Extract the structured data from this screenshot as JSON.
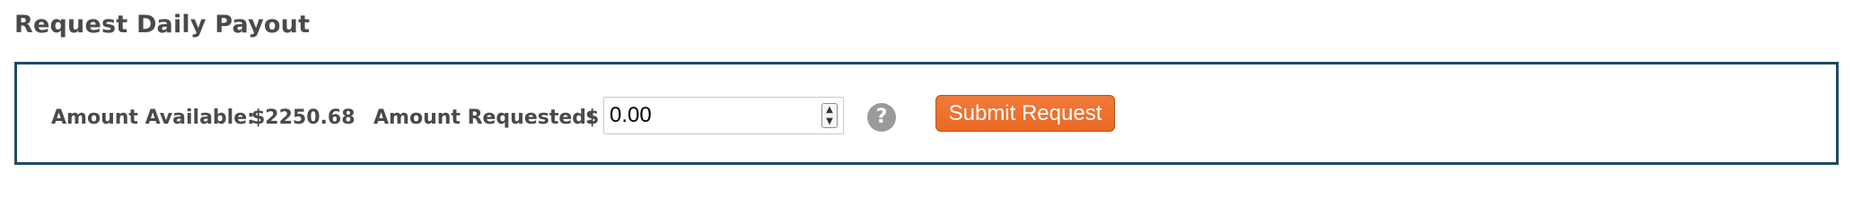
{
  "page": {
    "title": "Request Daily Payout"
  },
  "payout_form": {
    "amount_available_label": "Amount Available:",
    "amount_available_value": "$2250.68",
    "amount_requested_label": "Amount Requested:",
    "currency_symbol": "$",
    "amount_requested_value": "0.00",
    "stepper_up_icon": "chevron-up-icon",
    "stepper_down_icon": "chevron-down-icon",
    "help_icon": "question-mark-icon",
    "help_glyph": "?",
    "submit_label": "Submit Request"
  },
  "colors": {
    "panel_border": "#1f4a63",
    "title_text": "#4a4a4a",
    "submit_button": "#eb6a25",
    "help_icon": "#9a9a9a"
  }
}
